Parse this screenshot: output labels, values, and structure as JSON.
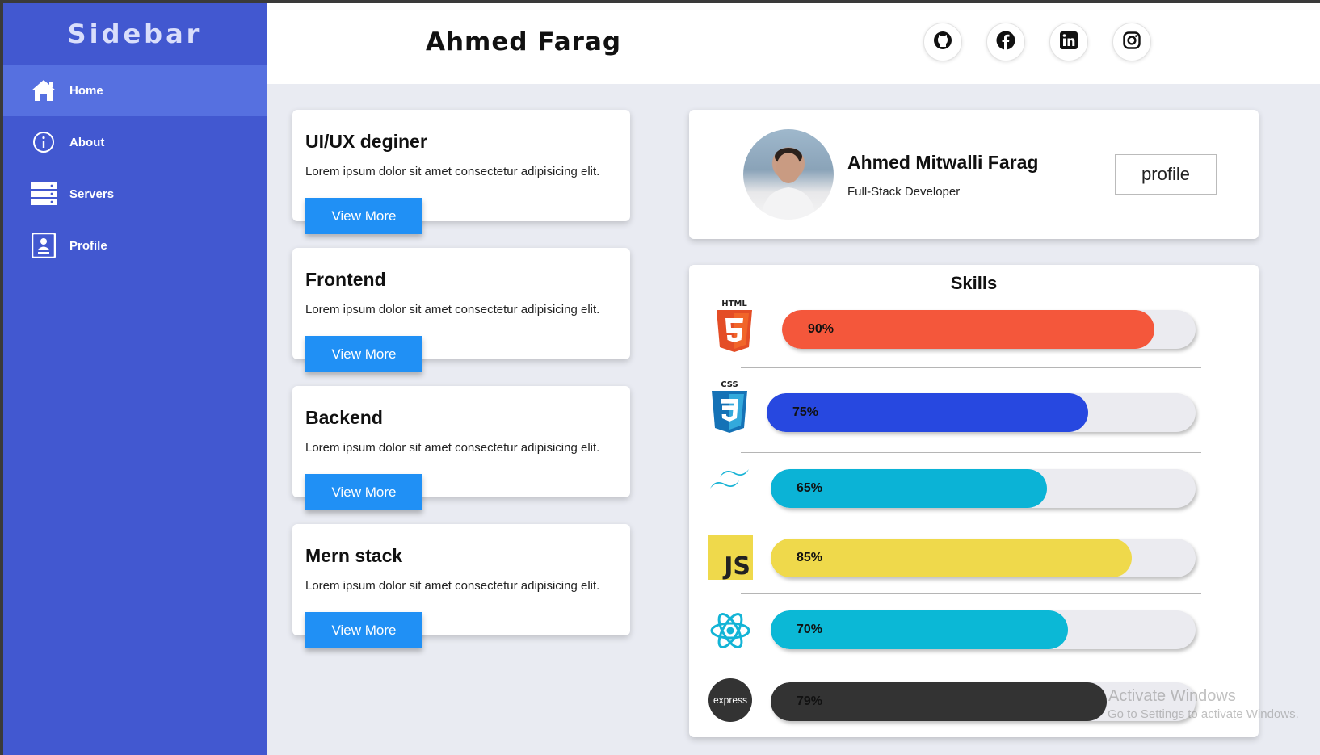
{
  "sidebar": {
    "title": "Sidebar",
    "items": [
      {
        "label": "Home",
        "icon": "home-icon"
      },
      {
        "label": "About",
        "icon": "info-icon"
      },
      {
        "label": "Servers",
        "icon": "servers-icon"
      },
      {
        "label": "Profile",
        "icon": "profile-icon"
      }
    ]
  },
  "header": {
    "name": "Ahmed Farag",
    "socials": [
      "github-icon",
      "facebook-icon",
      "linkedin-icon",
      "instagram-icon"
    ]
  },
  "services": [
    {
      "title": "UI/UX deginer",
      "text": "Lorem ipsum dolor sit amet consectetur adipisicing elit.",
      "button": "View More"
    },
    {
      "title": "Frontend",
      "text": "Lorem ipsum dolor sit amet consectetur adipisicing elit.",
      "button": "View More"
    },
    {
      "title": "Backend",
      "text": "Lorem ipsum dolor sit amet consectetur adipisicing elit.",
      "button": "View More"
    },
    {
      "title": "Mern stack",
      "text": "Lorem ipsum dolor sit amet consectetur adipisicing elit.",
      "button": "View More"
    }
  ],
  "profile": {
    "name": "Ahmed Mitwalli Farag",
    "role": "Full-Stack Developer",
    "button": "profile"
  },
  "skills": {
    "title": "Skills",
    "items": [
      {
        "name": "html5-logo",
        "logo_text": "HTML",
        "percent": 90,
        "label": "90%",
        "color": "#f4573b"
      },
      {
        "name": "css3-logo",
        "logo_text": "CSS",
        "percent": 75,
        "label": "75%",
        "color": "#2748e0"
      },
      {
        "name": "tailwind-logo",
        "percent": 65,
        "label": "65%",
        "color": "#0bb3d6"
      },
      {
        "name": "javascript-logo",
        "logo_text": "JS",
        "percent": 85,
        "label": "85%",
        "color": "#efd94b"
      },
      {
        "name": "react-logo",
        "percent": 70,
        "label": "70%",
        "color": "#0bb8d6"
      },
      {
        "name": "express-logo",
        "logo_text": "express",
        "percent": 79,
        "label": "79%",
        "color": "#333333"
      }
    ]
  },
  "watermark": {
    "line1": "Activate Windows",
    "line2": "Go to Settings to activate Windows."
  }
}
